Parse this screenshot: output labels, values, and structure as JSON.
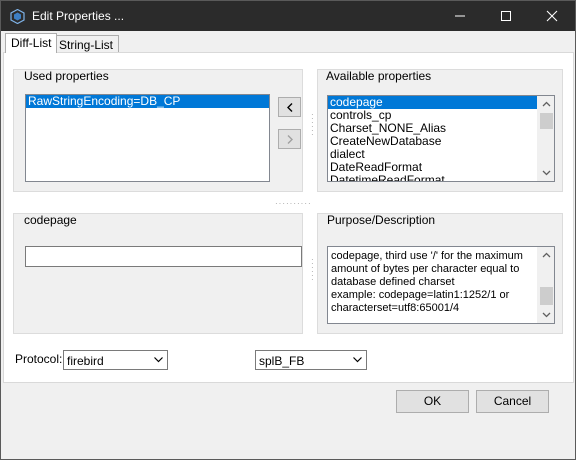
{
  "window": {
    "title": "Edit Properties ...",
    "controls": {
      "minimize": "minimize-icon",
      "maximize": "maximize-icon",
      "close": "close-icon"
    }
  },
  "tabs": [
    {
      "label": "Diff-List",
      "active": true
    },
    {
      "label": "String-List",
      "active": false
    }
  ],
  "used_properties": {
    "label": "Used properties",
    "items": [
      "RawStringEncoding=DB_CP"
    ],
    "selected_index": 0
  },
  "move_buttons": {
    "add": "‹",
    "remove": "›"
  },
  "available_properties": {
    "label": "Available properties",
    "items": [
      "codepage",
      "controls_cp",
      "Charset_NONE_Alias",
      "CreateNewDatabase",
      "dialect",
      "DateReadFormat",
      "DatetimeReadFormat"
    ],
    "selected_index": 0
  },
  "value_section": {
    "label": "codepage",
    "value": ""
  },
  "purpose": {
    "label": "Purpose/Description",
    "text": "codepage, third use '/' for the maximum amount of bytes per character equal to database defined charset\nexample: codepage=latin1:1252/1 or characterset=utf8:65001/4"
  },
  "protocol": {
    "label": "Protocol:",
    "protocol_value": "firebird",
    "library_value": "splB_FB"
  },
  "buttons": {
    "ok": "OK",
    "cancel": "Cancel"
  },
  "colors": {
    "titlebar": "#2b2b2b",
    "selection": "#0078d7",
    "dialog_bg": "#f0f0f0"
  }
}
